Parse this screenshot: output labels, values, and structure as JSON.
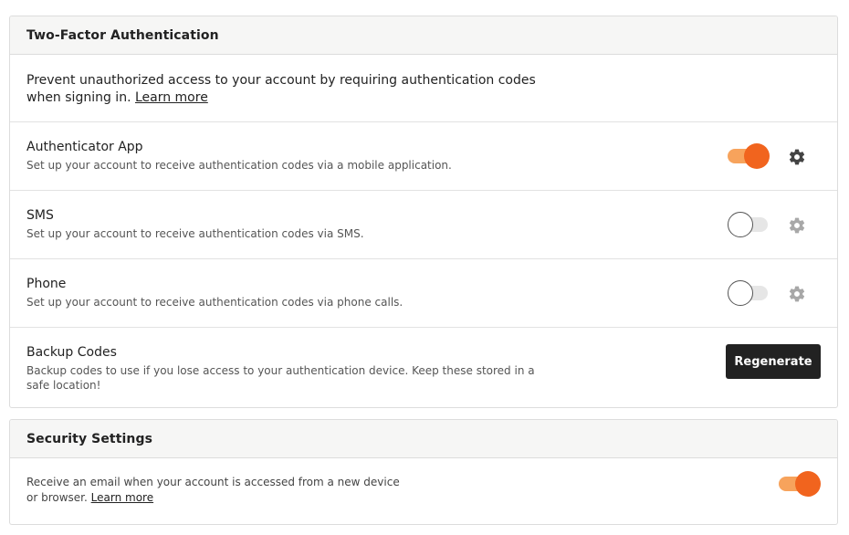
{
  "two_factor": {
    "title": "Two-Factor Authentication",
    "intro": "Prevent unauthorized access to your account by requiring authentication codes when signing in.",
    "learn_more": "Learn more",
    "methods": [
      {
        "title": "Authenticator App",
        "description": "Set up your account to receive authentication codes via a mobile application.",
        "enabled": true
      },
      {
        "title": "SMS",
        "description": "Set up your account to receive authentication codes via SMS.",
        "enabled": false
      },
      {
        "title": "Phone",
        "description": "Set up your account to receive authentication codes via phone calls.",
        "enabled": false
      }
    ],
    "backup": {
      "title": "Backup Codes",
      "description": "Backup codes to use if you lose access to your authentication device. Keep these stored in a safe location!",
      "button_label": "Regenerate"
    }
  },
  "security_settings": {
    "title": "Security Settings",
    "email_alert_text": "Receive an email when your account is accessed from a new device or browser.",
    "learn_more": "Learn more",
    "email_alert_enabled": true
  },
  "colors": {
    "accent": "#f1641e",
    "accent_light": "#f7a35c",
    "button_dark": "#222222"
  }
}
